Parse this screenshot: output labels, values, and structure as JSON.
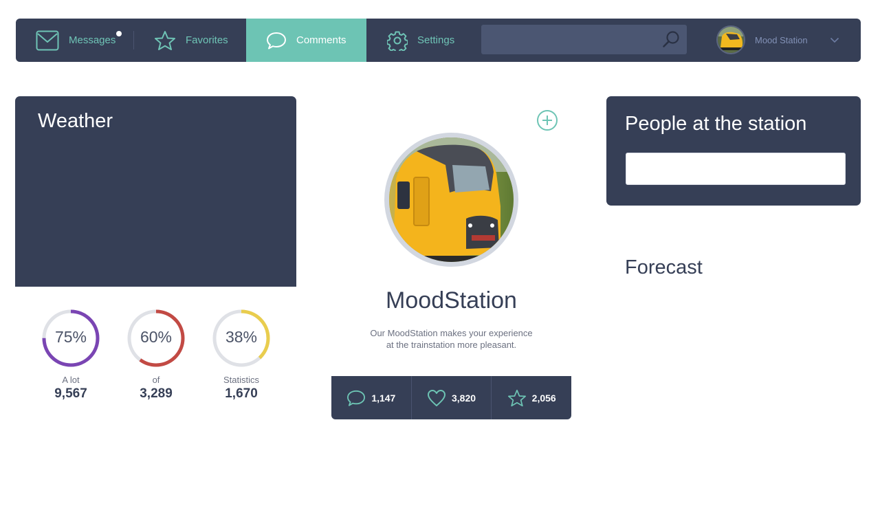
{
  "nav": {
    "messages": "Messages",
    "favorites": "Favorites",
    "comments": "Comments",
    "settings": "Settings",
    "search_placeholder": "",
    "user_name": "Mood Station"
  },
  "weather": {
    "title": "Weather"
  },
  "stats": [
    {
      "percent_label": "75%",
      "percent": 0.75,
      "caption": "A lot",
      "value": "9,567",
      "color": "#7a45b3"
    },
    {
      "percent_label": "60%",
      "percent": 0.6,
      "caption": "of",
      "value": "3,289",
      "color": "#c24a44"
    },
    {
      "percent_label": "38%",
      "percent": 0.38,
      "caption": "Statistics",
      "value": "1,670",
      "color": "#e9cd4e"
    }
  ],
  "profile": {
    "name": "MoodStation",
    "description_line1": "Our MoodStation makes your experience",
    "description_line2": "at the trainstation more pleasant.",
    "comments_count": "1,147",
    "likes_count": "3,820",
    "favorites_count": "2,056"
  },
  "people": {
    "title": "People at the station",
    "input_placeholder": ""
  },
  "forecast": {
    "title": "Forecast"
  },
  "colors": {
    "navy": "#363f56",
    "teal": "#6dc4b4",
    "ring_track": "#dfe1e6"
  }
}
